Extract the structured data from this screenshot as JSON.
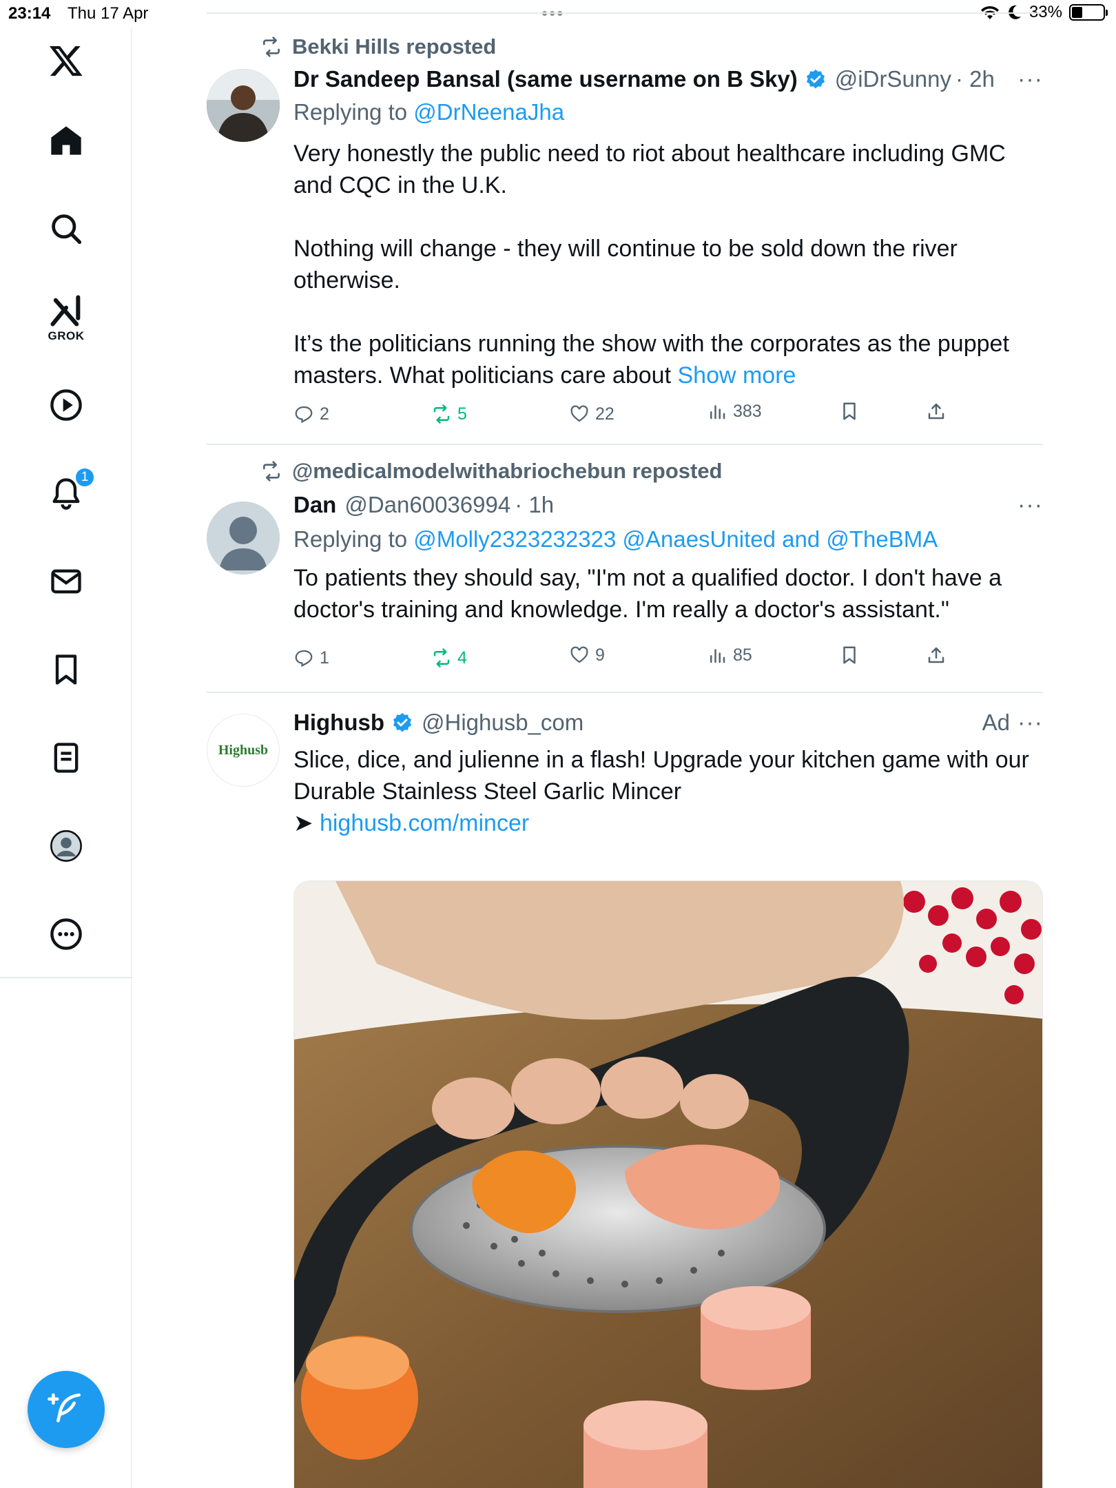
{
  "status_bar": {
    "time": "23:14",
    "date": "Thu 17 Apr",
    "battery": "33%",
    "battery_level": 0.33
  },
  "sidebar": {
    "items": [
      {
        "name": "x-logo",
        "icon": "x-logo-icon"
      },
      {
        "name": "home",
        "icon": "home-icon"
      },
      {
        "name": "explore",
        "icon": "search-icon"
      },
      {
        "name": "grok",
        "icon": "grok-icon",
        "label": "GROK"
      },
      {
        "name": "video",
        "icon": "play-icon"
      },
      {
        "name": "notifications",
        "icon": "bell-icon",
        "badge": "1"
      },
      {
        "name": "messages",
        "icon": "mail-icon"
      },
      {
        "name": "bookmarks",
        "icon": "bookmark-icon"
      },
      {
        "name": "lists",
        "icon": "list-icon"
      },
      {
        "name": "profile",
        "icon": "avatar-icon"
      },
      {
        "name": "more",
        "icon": "more-circle-icon"
      }
    ],
    "compose_icon": "compose-icon"
  },
  "feed": {
    "tweets": [
      {
        "repost_by": "Bekki Hills reposted",
        "name": "Dr Sandeep Bansal (same username on B Sky)",
        "verified": true,
        "handle": "@iDrSunny",
        "time": "· 2h",
        "replying_prefix": "Replying to",
        "replying_to": "@DrNeenaJha",
        "text": [
          "Very honestly the public need to riot about healthcare including GMC and CQC in the U.K.",
          "Nothing will change - they will continue to be sold down the river otherwise.",
          "It’s the politicians running the show with the corporates as the puppet masters. What politicians care about"
        ],
        "show_more": "Show more",
        "replies": "2",
        "reposts": "5",
        "likes": "22",
        "views": "383"
      },
      {
        "repost_by": "@medicalmodelwithabriochebun reposted",
        "name": "Dan",
        "verified": false,
        "handle": "@Dan60036994",
        "time": "· 1h",
        "replying_prefix": "Replying to",
        "replying_to": "@Molly2323232323 @AnaesUnited and @TheBMA",
        "text": [
          "To patients they should say, \"I'm not a qualified doctor. I don't have a doctor's training and knowledge. I'm really a doctor's assistant.\""
        ],
        "replies": "1",
        "reposts": "4",
        "likes": "9",
        "views": "85"
      },
      {
        "name": "Highusb",
        "verified": true,
        "handle": "@Highusb_com",
        "ad_label": "Ad",
        "avatar_text": "Highusb",
        "text": [
          "Slice, dice, and julienne in a flash! Upgrade your kitchen game with our Durable Stainless Steel Garlic Mincer"
        ],
        "link_arrow": "➤",
        "link": "highusb.com/mincer"
      }
    ]
  }
}
